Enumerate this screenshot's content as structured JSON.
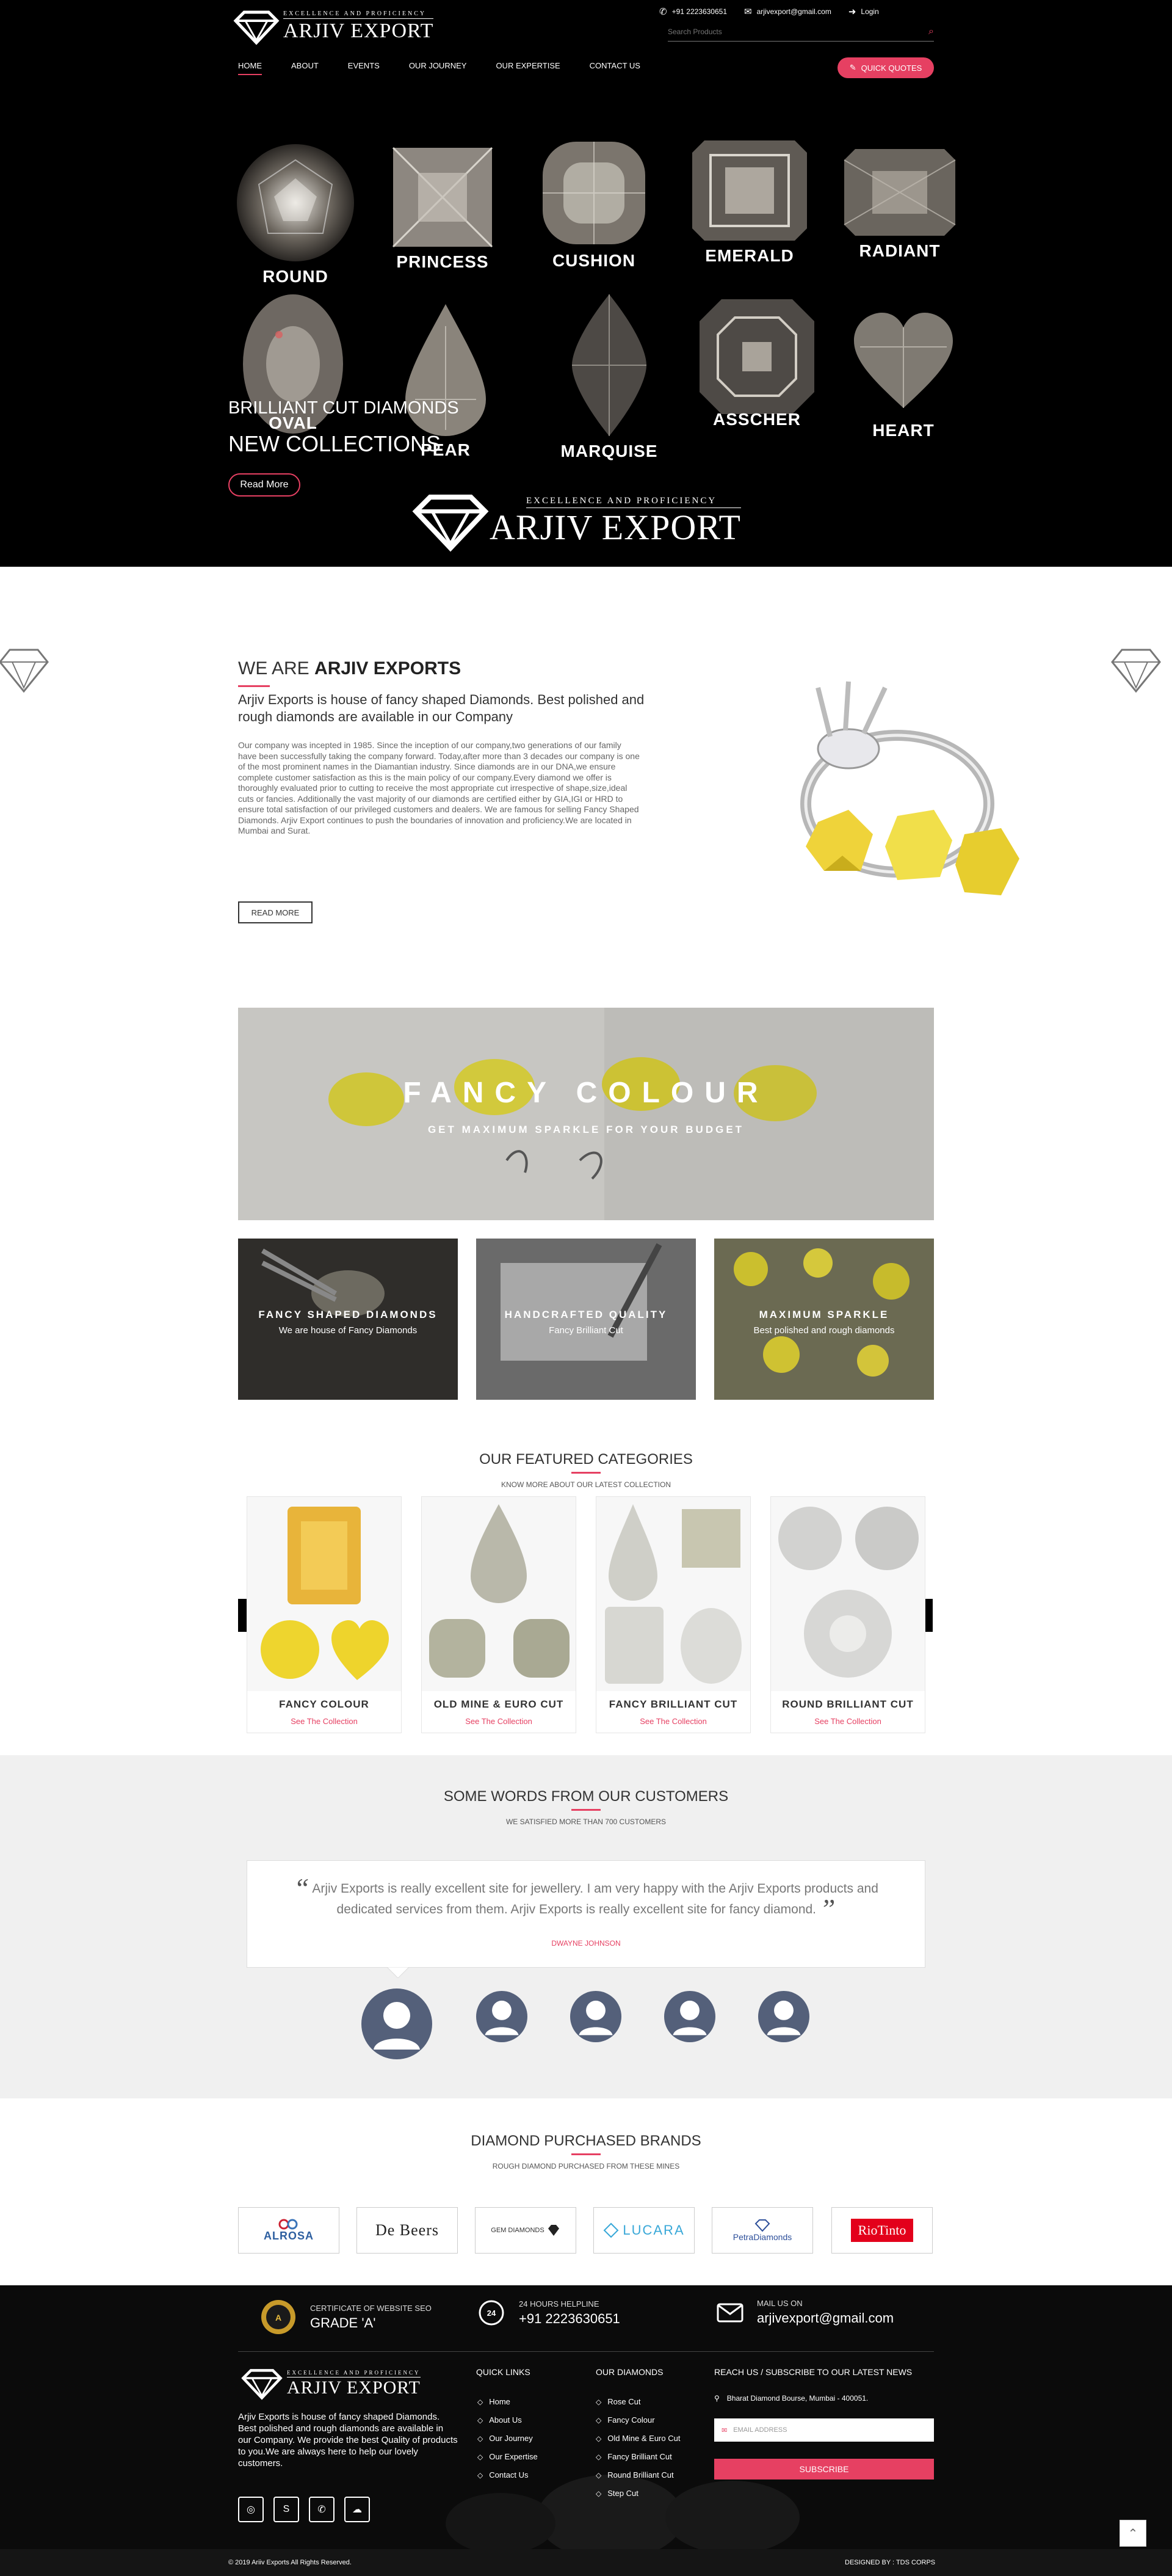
{
  "header": {
    "logo_tagline": "EXCELLENCE AND PROFICIENCY",
    "logo_name": "ARJIV EXPORT",
    "phone": "+91 2223630651",
    "email": "arjivexport@gmail.com",
    "login": "Login",
    "search_placeholder": "Search Products",
    "nav": [
      "HOME",
      "ABOUT",
      "EVENTS",
      "OUR JOURNEY",
      "OUR EXPERTISE",
      "CONTACT US"
    ],
    "quick_quotes": "QUICK QUOTES"
  },
  "hero": {
    "shapes": [
      "ROUND",
      "PRINCESS",
      "CUSHION",
      "EMERALD",
      "RADIANT",
      "OVAL",
      "PEAR",
      "MARQUISE",
      "ASSCHER",
      "HEART"
    ],
    "line1": "BRILLIANT CUT DIAMONDS",
    "line2": "NEW COLLECTIONS",
    "read_more": "Read More",
    "logo_tagline": "EXCELLENCE AND PROFICIENCY",
    "logo_name": "ARJIV EXPORT"
  },
  "about": {
    "title_prefix": "WE ARE ",
    "title_bold": "ARJIV EXPORTS",
    "lead": "Arjiv Exports is house of fancy shaped Diamonds. Best polished and rough diamonds are available in our Company",
    "body": "Our company was incepted in 1985. Since the inception of our company,two generations of our family have been successfully taking the company forward. Today,after more than 3 decades our company is one of the most prominent names in the Diamantian industry. Since diamonds are in our DNA,we ensure complete customer satisfaction as this is the main policy of our company.Every diamond we offer is thoroughly evaluated prior to cutting to receive the most appropriate cut irrespective of shape,size,ideal cuts or fancies. Additionally the vast majority of our diamonds are certified either by GIA,IGI or HRD to ensure total satisfaction of our privileged customers and dealers. We are famous for selling Fancy Shaped Diamonds. Arjiv Export continues to push the boundaries of innovation and proficiency.We are located in Mumbai and Surat.",
    "button": "READ MORE"
  },
  "fancy_banner": {
    "title": "FANCY COLOUR",
    "subtitle": "GET MAXIMUM SPARKLE FOR YOUR BUDGET"
  },
  "promo_cards": [
    {
      "title": "FANCY SHAPED DIAMONDS",
      "subtitle": "We are house of Fancy Diamonds"
    },
    {
      "title": "HANDCRAFTED QUALITY",
      "subtitle": "Fancy Brilliant Cut"
    },
    {
      "title": "MAXIMUM SPARKLE",
      "subtitle": "Best polished and rough diamonds"
    }
  ],
  "featured": {
    "title": "OUR FEATURED CATEGORIES",
    "subtitle": "KNOW MORE ABOUT OUR LATEST COLLECTION",
    "link": "See The Collection",
    "items": [
      "FANCY COLOUR",
      "OLD MINE & EURO CUT",
      "FANCY BRILLIANT CUT",
      "ROUND BRILLIANT CUT"
    ]
  },
  "testimonials": {
    "title": "SOME WORDS FROM OUR CUSTOMERS",
    "subtitle": "WE SATISFIED MORE THAN 700 CUSTOMERS",
    "quote": "Arjiv Exports is really excellent site for jewellery. I am very happy with the Arjiv Exports products and dedicated services from them. Arjiv Exports is really excellent site for fancy diamond.",
    "author": "DWAYNE JOHNSON"
  },
  "brands": {
    "title": "DIAMOND PURCHASED BRANDS",
    "subtitle": "ROUGH DIAMOND PURCHASED FROM THESE MINES",
    "items": [
      "ALROSA",
      "De Beers",
      "GEM DIAMONDS",
      "LUCARA",
      "PetraDiamonds",
      "RioTinto"
    ]
  },
  "footer": {
    "cert_label": "CERTIFICATE OF WEBSITE SEO",
    "cert_value": "GRADE 'A'",
    "helpline_label": "24 HOURS HELPLINE",
    "helpline_value": "+91 2223630651",
    "mail_label": "MAIL US ON",
    "mail_value": "arjivexport@gmail.com",
    "logo_tagline": "EXCELLENCE AND PROFICIENCY",
    "logo_name": "ARJIV EXPORT",
    "description": "Arjiv Exports is house of fancy shaped Diamonds. Best polished and rough diamonds are available in our Company. We provide the best Quality of products to you.We are always here to help our lovely customers.",
    "quick_links_title": "QUICK LINKS",
    "quick_links": [
      "Home",
      "About Us",
      "Our Journey",
      "Our Expertise",
      "Contact Us"
    ],
    "diamonds_title": "OUR DIAMONDS",
    "diamonds": [
      "Rose Cut",
      "Fancy Colour",
      "Old Mine & Euro Cut",
      "Fancy Brilliant Cut",
      "Round Brilliant Cut",
      "Step Cut"
    ],
    "reach_title": "REACH US / SUBSCRIBE TO OUR LATEST NEWS",
    "address": "Bharat Diamond Bourse, Mumbai - 400051.",
    "email_placeholder": "EMAIL ADDRESS",
    "subscribe": "SUBSCRIBE",
    "copyright": "© 2019 Ariiv Exports All Rights Reserved.",
    "designed_by": "DESIGNED BY : TDS CORPS"
  },
  "colors": {
    "accent": "#e64062",
    "dark": "#000000",
    "avatar": "#54607a"
  }
}
